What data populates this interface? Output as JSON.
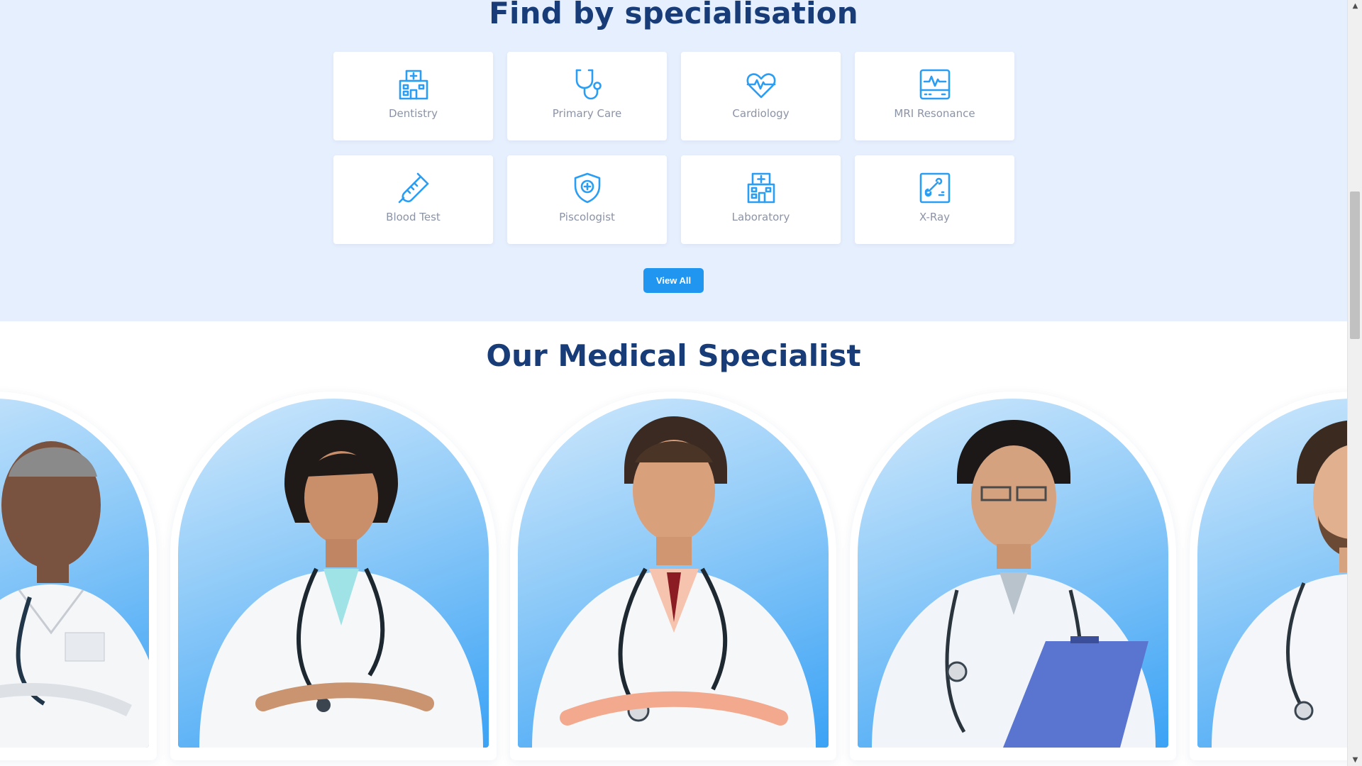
{
  "specialisation": {
    "title": "Find by specialisation",
    "cards": [
      {
        "label": "Dentistry",
        "icon": "hospital-icon"
      },
      {
        "label": "Primary Care",
        "icon": "stethoscope-icon"
      },
      {
        "label": "Cardiology",
        "icon": "heart-pulse-icon"
      },
      {
        "label": "MRI Resonance",
        "icon": "monitor-pulse-icon"
      },
      {
        "label": "Blood Test",
        "icon": "test-tube-icon"
      },
      {
        "label": "Piscologist",
        "icon": "shield-plus-icon"
      },
      {
        "label": "Laboratory",
        "icon": "hospital-icon"
      },
      {
        "label": "X-Ray",
        "icon": "xray-bone-icon"
      }
    ],
    "view_all_label": "View All"
  },
  "specialists": {
    "title": "Our Medical Specialist",
    "doctors": [
      {
        "name": "doctor-1",
        "visible": "partial-left"
      },
      {
        "name": "doctor-2"
      },
      {
        "name": "doctor-3"
      },
      {
        "name": "doctor-4"
      },
      {
        "name": "doctor-5",
        "visible": "partial-right"
      }
    ]
  },
  "colors": {
    "accent": "#2196f0",
    "heading": "#173c78",
    "section_bg": "#e6effd",
    "icon": "#2a9df4"
  }
}
